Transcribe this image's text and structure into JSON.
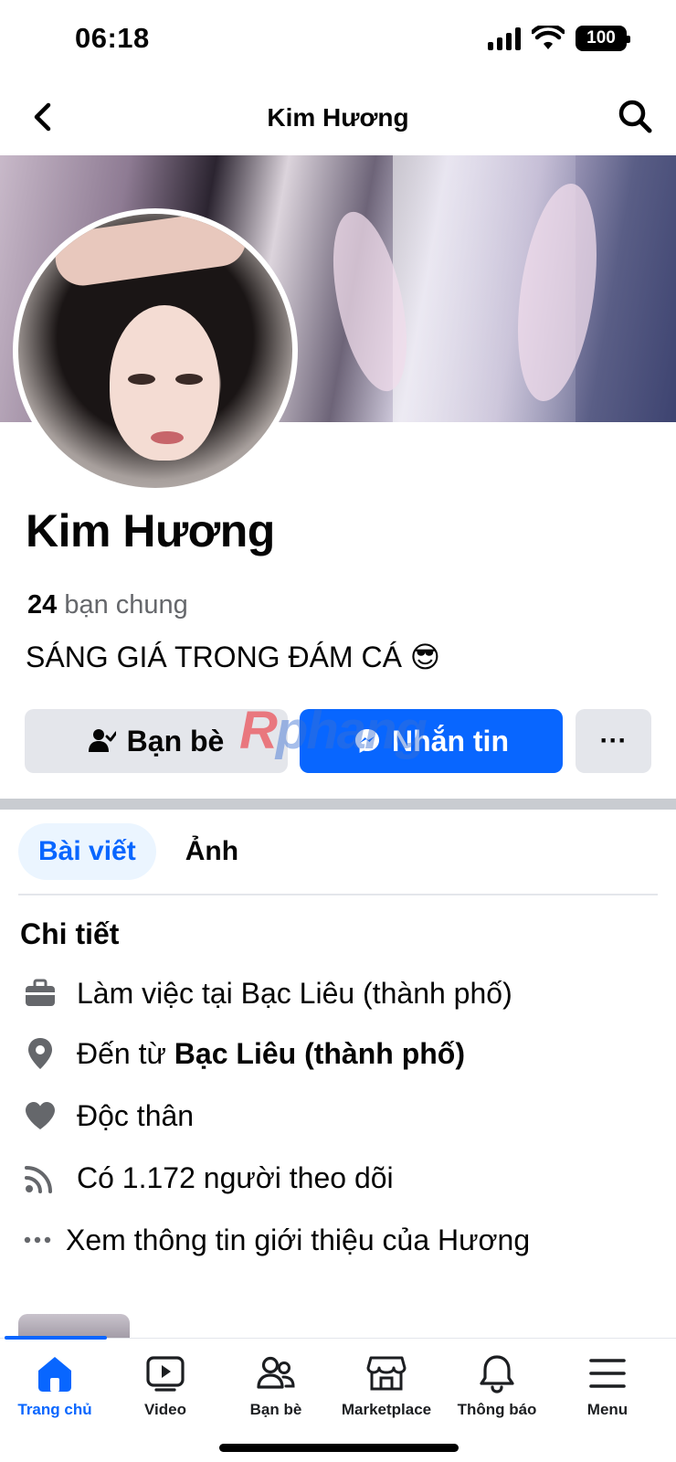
{
  "status_bar": {
    "time": "06:18",
    "battery": "100"
  },
  "header": {
    "title": "Kim Hương"
  },
  "profile": {
    "name": "Kim Hương",
    "mutual_count": "24",
    "mutual_label": "bạn chung",
    "bio": "SÁNG GIÁ TRONG ĐÁM CÁ 😎"
  },
  "actions": {
    "friends_label": "Bạn bè",
    "message_label": "Nhắn tin",
    "more_label": "···"
  },
  "watermark": {
    "part1": "R",
    "part2": "phang"
  },
  "tabs": [
    {
      "label": "Bài viết",
      "active": true
    },
    {
      "label": "Ảnh",
      "active": false
    }
  ],
  "details": {
    "title": "Chi tiết",
    "work": "Làm việc tại Bạc Liêu (thành phố)",
    "from_prefix": "Đến từ ",
    "from_place": "Bạc Liêu (thành phố)",
    "relationship": "Độc thân",
    "followers": "Có 1.172 người theo dõi",
    "see_more": "Xem thông tin giới thiệu của Hương"
  },
  "bottom_nav": [
    {
      "label": "Trang chủ",
      "icon": "home-icon",
      "active": true
    },
    {
      "label": "Video",
      "icon": "video-icon",
      "active": false
    },
    {
      "label": "Bạn bè",
      "icon": "friends-icon",
      "active": false
    },
    {
      "label": "Marketplace",
      "icon": "marketplace-icon",
      "active": false
    },
    {
      "label": "Thông báo",
      "icon": "bell-icon",
      "active": false
    },
    {
      "label": "Menu",
      "icon": "menu-icon",
      "active": false
    }
  ],
  "colors": {
    "accent": "#0866ff",
    "button_gray": "#e4e6eb",
    "secondary_text": "#65676b"
  }
}
